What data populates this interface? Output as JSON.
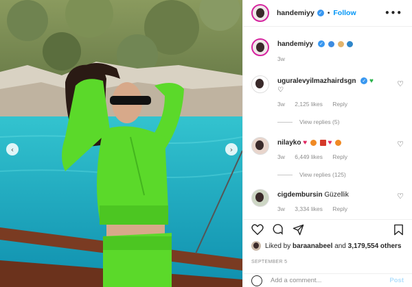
{
  "post": {
    "author": "handemiyy",
    "follow_label": "Follow",
    "more_label": "•••",
    "caption_age": "3w",
    "caption_emojis": [
      "wave-icon",
      "face-icon",
      "globe-icon"
    ]
  },
  "comments": [
    {
      "user": "ugurаlevyilmazhairdsgn",
      "text": "",
      "age": "3w",
      "likes": "2,125 likes",
      "reply": "Reply",
      "view_replies": "View replies (5)",
      "emojis": [
        "green-heart-icon",
        "white-heart-icon"
      ]
    },
    {
      "user": "nilayko",
      "text": "",
      "age": "3w",
      "likes": "6,449 likes",
      "reply": "Reply",
      "view_replies": "View replies (125)",
      "emojis": [
        "red-heart-icon",
        "fire-icon",
        "hundred-icon",
        "red-heart-icon",
        "fire-icon"
      ]
    },
    {
      "user": "cigdembursin",
      "text": "Güzellik",
      "age": "3w",
      "likes": "3,334 likes",
      "reply": "Reply"
    }
  ],
  "likes": {
    "prefix": "Liked by",
    "liker": "baraanabeel",
    "and": "and",
    "others": "3,179,554 others"
  },
  "date": "SEPTEMBER 5",
  "add_comment": {
    "placeholder": "Add a comment...",
    "post_label": "Post"
  },
  "colors": {
    "accent": "#0095f6",
    "verified": "#3897f0",
    "outfit": "#5bd92a",
    "sea": "#1db0c4"
  }
}
